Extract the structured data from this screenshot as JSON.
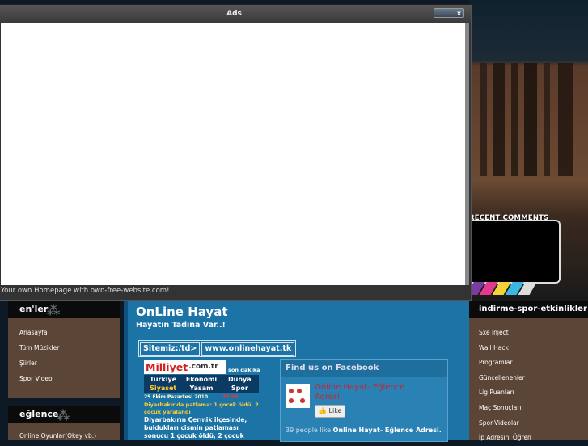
{
  "ads_window": {
    "title": "Ads",
    "control_label": "x",
    "footer": "Your own Homepage with own-free-website.com!"
  },
  "header_right": {
    "recent_comments_label": "RECENT COMMENTS"
  },
  "left_sidebar": {
    "section1": {
      "title": "en'ler",
      "items": [
        "Anasayfa",
        "Tüm Müzikler",
        "Şiirler",
        "Spor Video"
      ]
    },
    "section2": {
      "title": "eğlence",
      "items": [
        "Online Oyunlar(Okey vb.)"
      ]
    }
  },
  "main": {
    "site_title": "OnLine Hayat",
    "tagline": "Hayatın Tadına Var..!",
    "sitemiz_label": "Sitemiz:/td>",
    "sitemiz_url": "www.onlinehayat.tk",
    "milliyet": {
      "logo": "Milliyet",
      "logo_suffix": ".com.tr",
      "son_dakika": "son dakika",
      "menu": [
        "Türkiye",
        "Ekonomi",
        "Dunya",
        "Siyaset",
        "Yasam",
        "Spor"
      ],
      "date": "25 Ekim Pazartesi 2010",
      "date_extra": "12:16",
      "headline": "Diyarbakır'da patlama: 1 çocuk öldü, 2 çocuk yaralandı",
      "body": "Diyarbakırın Çermik ilçesinde, buldukları cismin patlaması sonucu 1 çocuk öldü, 2 çocuk"
    },
    "facebook": {
      "title": "Find us on Facebook",
      "page_name": "Online Hayat- Eğlence Adresi",
      "like_label": "Like",
      "count_prefix": "39 people like",
      "count_page": "Online Hayat- Eğlence Adresi."
    }
  },
  "right_sidebar": {
    "title": "indirme-spor-etkinlikler",
    "items": [
      "Sxe Inject",
      "Wall Hack",
      "Programlar",
      "Güncellenenler",
      "Lig Puanları",
      "Maç Sonuçları",
      "Spor-Videolar",
      "İp Adresini Öğren"
    ]
  },
  "colors": {
    "main_blue": "#1b73a6",
    "sidebar_brown": "#5b4537",
    "header_black": "#0b0b0b"
  }
}
